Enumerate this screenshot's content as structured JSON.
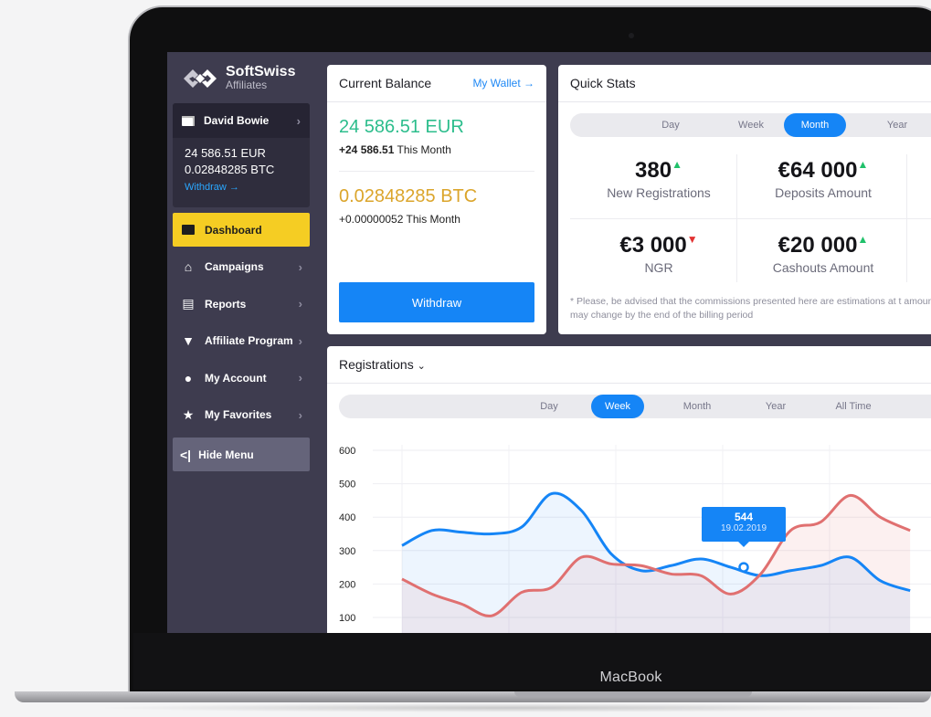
{
  "device": {
    "brand": "MacBook"
  },
  "sidebar": {
    "logo_name": "SoftSwiss",
    "logo_sub": "Affiliates",
    "user": {
      "name": "David Bowie",
      "eur": "24 586.51 EUR",
      "btc": "0.02848285 BTC",
      "withdraw": "Withdraw →"
    },
    "items": [
      {
        "label": "Dashboard",
        "icon": "card-icon",
        "active": true
      },
      {
        "label": "Campaigns",
        "icon": "home-icon"
      },
      {
        "label": "Reports",
        "icon": "clipboard-icon"
      },
      {
        "label": "Affiliate Program",
        "icon": "diamond-icon"
      },
      {
        "label": "My Account",
        "icon": "user-icon"
      },
      {
        "label": "My Favorites",
        "icon": "star-icon"
      }
    ],
    "hide_menu": "Hide Menu"
  },
  "balance": {
    "title": "Current Balance",
    "wallet_link": "My Wallet →",
    "eur_value": "24 586.51 EUR",
    "eur_change_amount": "+24 586.51",
    "eur_change_label": " This Month",
    "btc_value": "0.02848285 BTC",
    "btc_change": "+0.00000052 This Month",
    "withdraw_button": "Withdraw"
  },
  "quick_stats": {
    "title": "Quick Stats",
    "periods": [
      "Day",
      "Week",
      "Month",
      "Year"
    ],
    "selected_period": "Month",
    "stats": [
      {
        "value": "380",
        "label": "New Registrations",
        "trend": "up"
      },
      {
        "value": "€64 000",
        "label": "Deposits Amount",
        "trend": "up"
      },
      {
        "value": "€3 000",
        "label": "NGR",
        "trend": "down"
      },
      {
        "value": "€20 000",
        "label": "Cashouts Amount",
        "trend": "up"
      }
    ],
    "note": "* Please, be advised that the commissions presented here are estimations at t amounts may change by the end of the billing period"
  },
  "registrations": {
    "title": "Registrations",
    "periods": [
      "Day",
      "Week",
      "Month",
      "Year",
      "All Time"
    ],
    "selected_period": "Week",
    "tooltip": {
      "value": "544",
      "date": "19.02.2019"
    }
  },
  "chart_data": {
    "type": "area",
    "title": "Registrations",
    "ylim": [
      50,
      620
    ],
    "yticks": [
      100,
      200,
      300,
      400,
      500,
      600
    ],
    "grid": true,
    "series": [
      {
        "color": "#1585f6",
        "values": [
          315,
          360,
          355,
          350,
          370,
          470,
          420,
          290,
          240,
          255,
          275,
          250,
          225,
          240,
          255,
          280,
          210,
          180
        ]
      },
      {
        "color": "#e07070",
        "values": [
          215,
          170,
          140,
          105,
          175,
          190,
          280,
          260,
          255,
          230,
          225,
          170,
          230,
          360,
          385,
          465,
          400,
          360
        ]
      }
    ],
    "colors": {
      "accent": "#1585f6",
      "highlight": "#f5cd23",
      "eur": "#2cbd8c",
      "btc": "#dba52b"
    }
  }
}
